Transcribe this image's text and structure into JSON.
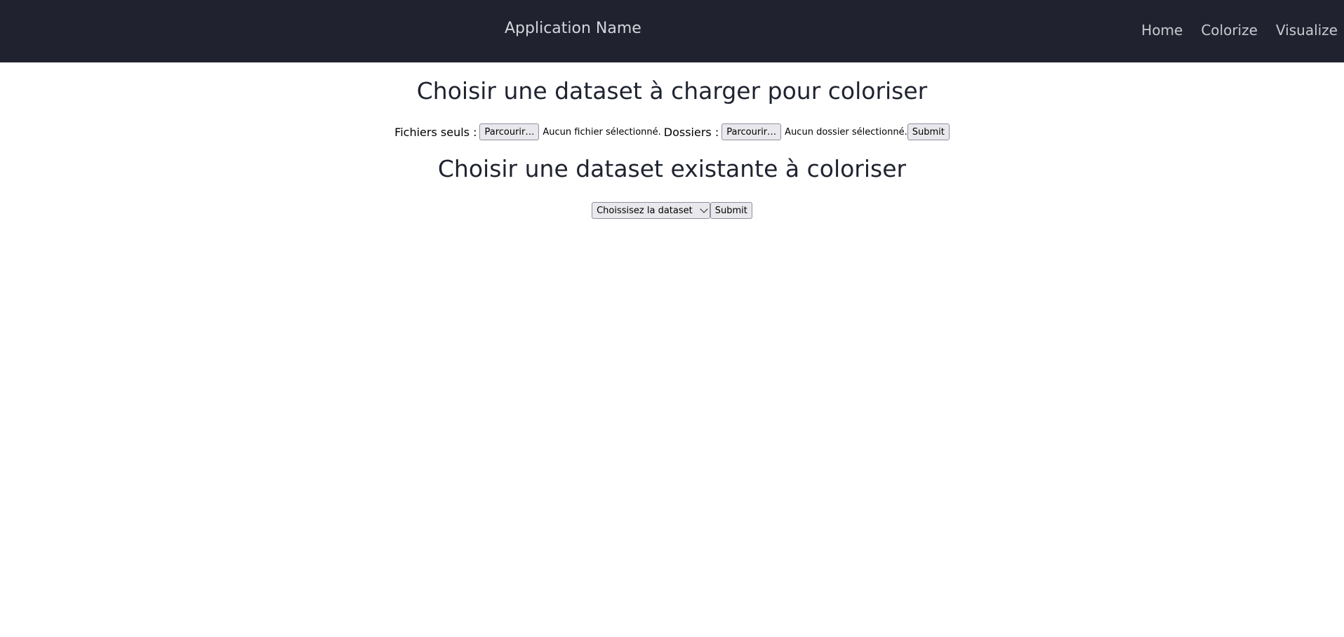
{
  "navbar": {
    "app_name": "Application Name",
    "links": [
      "Home",
      "Colorize",
      "Visualize"
    ]
  },
  "upload_section": {
    "heading": "Choisir une dataset à charger pour coloriser",
    "files_label": "Fichiers seuls :",
    "files_browse": "Parcourir…",
    "files_status": "Aucun fichier sélectionné.",
    "folders_label": "Dossiers :",
    "folders_browse": "Parcourir…",
    "folders_status": "Aucun dossier sélectionné.",
    "submit": "Submit"
  },
  "existing_section": {
    "heading": "Choisir une dataset existante à coloriser",
    "select_value": "Choissisez la dataset",
    "submit": "Submit"
  },
  "colors": {
    "navbar_bg": "#20232f",
    "heading_text": "#1f2330"
  }
}
